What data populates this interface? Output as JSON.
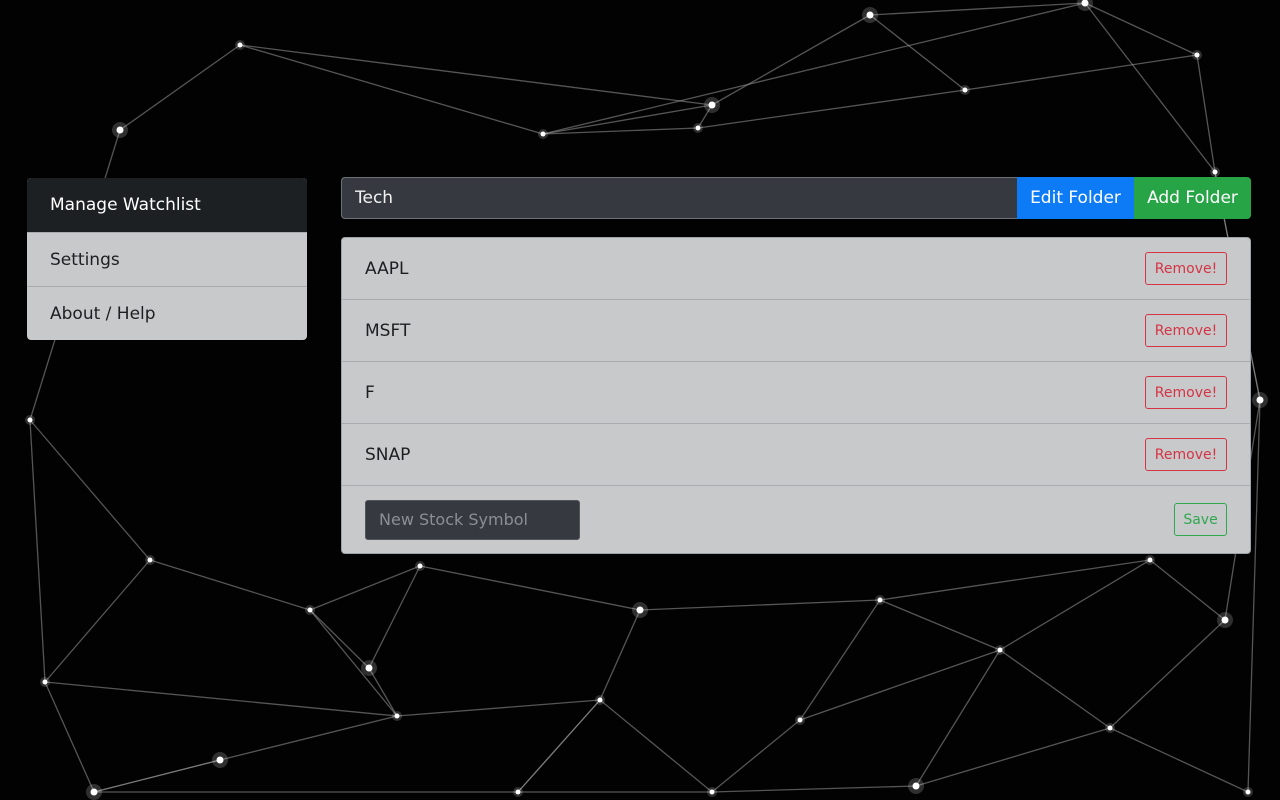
{
  "sidebar": {
    "items": [
      {
        "label": "Manage Watchlist",
        "active": true
      },
      {
        "label": "Settings",
        "active": false
      },
      {
        "label": "About / Help",
        "active": false
      }
    ]
  },
  "folder": {
    "current_name": "Tech",
    "edit_label": "Edit Folder",
    "add_label": "Add Folder"
  },
  "watchlist": {
    "stocks": [
      {
        "symbol": "AAPL",
        "remove_label": "Remove!"
      },
      {
        "symbol": "MSFT",
        "remove_label": "Remove!"
      },
      {
        "symbol": "F",
        "remove_label": "Remove!"
      },
      {
        "symbol": "SNAP",
        "remove_label": "Remove!"
      }
    ],
    "new_symbol_placeholder": "New Stock Symbol",
    "new_symbol_value": "",
    "save_label": "Save"
  },
  "colors": {
    "primary": "#0d7bf5",
    "success": "#27a546",
    "danger": "#d53444",
    "panel": "#c8c9cb",
    "active_nav": "#1d2023"
  }
}
